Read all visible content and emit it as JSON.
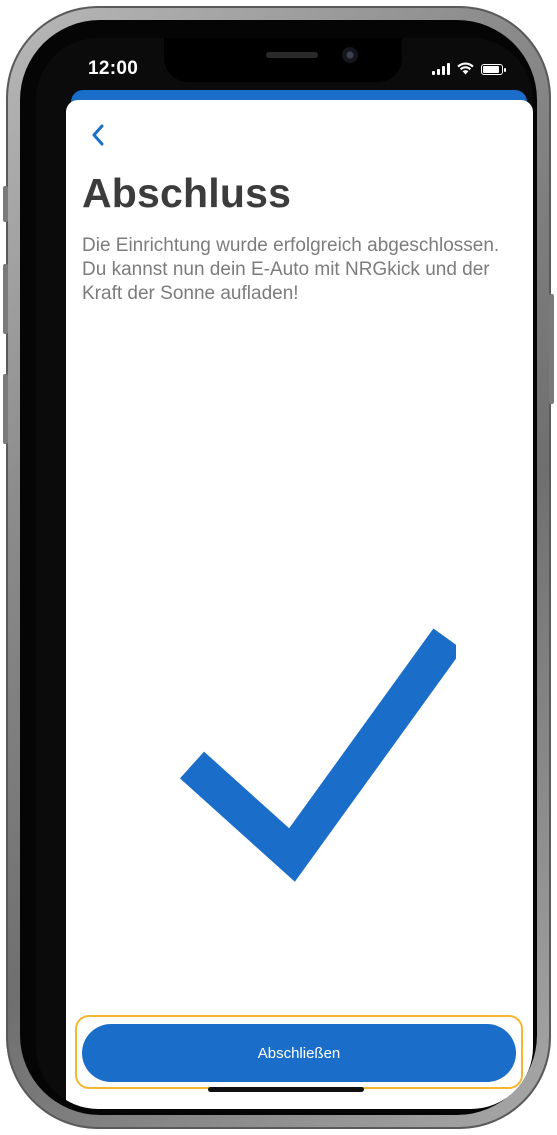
{
  "status_bar": {
    "time": "12:00",
    "icons": [
      "cellular-signal-icon",
      "wifi-icon",
      "battery-icon"
    ]
  },
  "header": {
    "back_icon": "chevron-left-icon"
  },
  "main": {
    "title": "Abschluss",
    "description": "Die Einrichtung wurde erfolgreich abgeschlossen. Du kannst nun dein E-Auto mit NRGkick und der Kraft der Sonne aufladen!",
    "illustration_icon": "checkmark-icon"
  },
  "footer": {
    "finish_label": "Abschließen"
  },
  "colors": {
    "accent": "#1a6ec9",
    "highlight": "#f5b731",
    "title": "#3c3c3c",
    "text_secondary": "#7c7c7c"
  }
}
